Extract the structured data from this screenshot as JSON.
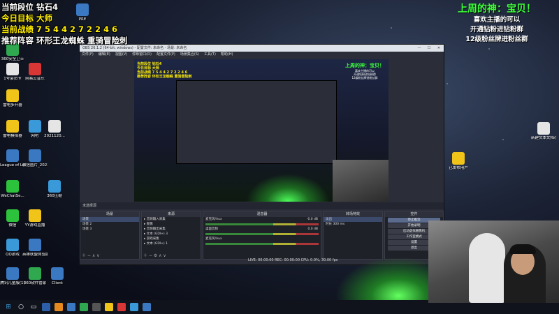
{
  "overlay": {
    "rank": "当前段位 钻石4",
    "goal": "今日目标 大师",
    "record": "当前战绩 7 5 4 4 2 7 2 2 4 6",
    "recommend": "推荐阵容 环形王龙蜘蛛 重骑冒险刺",
    "god_title": "上周的神：宝贝！",
    "notice_1": "喜欢主播的可以",
    "notice_2": "开通钻粉进钻粉群",
    "notice_3": "12级粉丝牌进粉丝群"
  },
  "desktop_icons": [
    {
      "label": "360安全卫士",
      "color": "#2fa84f"
    },
    {
      "label": "1号会员卡",
      "color": "#e5e5e5"
    },
    {
      "label": "雷电多开器",
      "color": "#f0c419"
    },
    {
      "label": "雷电模拟器",
      "color": "#f0c419"
    },
    {
      "label": "League of Legends",
      "color": "#3a78c2"
    },
    {
      "label": "WeChatSe...",
      "color": "#2cc23b"
    },
    {
      "label": "微信",
      "color": "#2cc23b"
    },
    {
      "label": "QQ游戏",
      "color": "#3a9ad9"
    },
    {
      "label": "腾讯儿童服(1)",
      "color": "#3a78c2"
    },
    {
      "label": "网易云音乐",
      "color": "#d93636"
    },
    {
      "label": "网吧",
      "color": "#3a9ad9"
    },
    {
      "label": "微信图片_202202...",
      "color": "#3a78c2"
    },
    {
      "label": "YY游戏直播",
      "color": "#f0c419"
    },
    {
      "label": "英雄联盟体验服",
      "color": "#3a78c2"
    },
    {
      "label": "360软件管家",
      "color": "#2fa84f"
    },
    {
      "label": "Client",
      "color": "#3a78c2"
    },
    {
      "label": "PRE",
      "color": "#3a78c2"
    },
    {
      "label": "2021120...",
      "color": "#e5e5e5"
    },
    {
      "label": "360压缩",
      "color": "#3a9ad9"
    },
    {
      "label": "新建文本文档(8)",
      "color": "#e5e5e5"
    },
    {
      "label": "已发布用户",
      "color": "#f0c419"
    }
  ],
  "obs": {
    "title": "OBS 26.1.2 (64-bit, windows) - 配置文件: 未命名 - 场景: 未命名",
    "menu": [
      "文件(F)",
      "编辑(E)",
      "视图(V)",
      "停靠窗口(D)",
      "配置文件(P)",
      "场景集合(S)",
      "工具(T)",
      "帮助(H)"
    ],
    "scene_bar": "未选择源",
    "docks": {
      "scenes": {
        "title": "场景",
        "items": [
          "场景",
          "场景 2",
          "场景 3"
        ]
      },
      "sources": {
        "title": "来源",
        "items": [
          "音频输入采集",
          "图像",
          "音频输出采集",
          "文本 (GDI+) 3",
          "游戏采集",
          "文本 (GDI+) 1"
        ]
      },
      "mixer": {
        "title": "混音器",
        "tracks": [
          {
            "name": "麦克风/Aux",
            "level": "-0.0 dB"
          },
          {
            "name": "桌面音频",
            "level": "0.0 dB"
          },
          {
            "name": "麦克风/Aux",
            "level": ""
          }
        ]
      },
      "transitions": {
        "title": "转场特效",
        "type": "淡出",
        "duration_label": "时长",
        "duration": "300 ms"
      },
      "controls": {
        "title": "控件",
        "buttons": [
          "停止推流",
          "开始录制",
          "启动虚拟摄像机",
          "工作室模式",
          "设置",
          "退出"
        ]
      }
    },
    "status": "LIVE: 00:00:00   REC: 00:00:00   CPU: 0.0%, 30.00 fps"
  }
}
